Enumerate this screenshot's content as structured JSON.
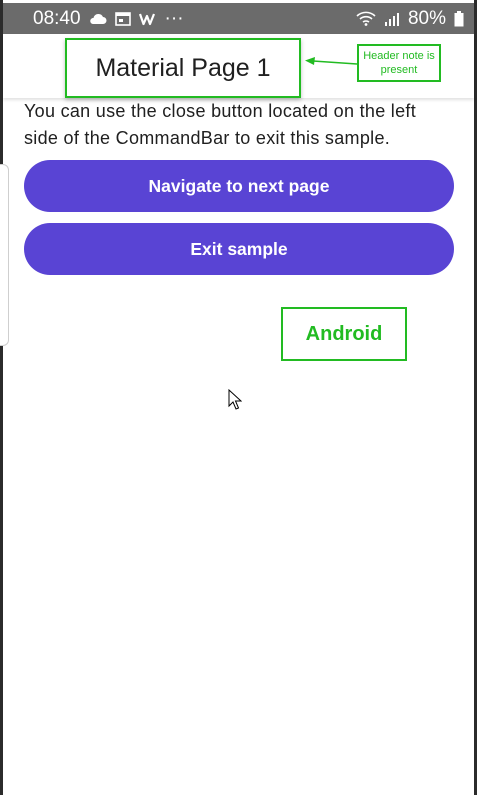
{
  "status_bar": {
    "time": "08:40",
    "more": "···",
    "battery": "80%",
    "icons": [
      "cloud-icon",
      "calendar-icon",
      "w-app-icon",
      "wifi-icon",
      "signal-icon",
      "battery-icon"
    ]
  },
  "header": {
    "title": "Material Page 1",
    "note": "Header note is present"
  },
  "content": {
    "description": "You can use the close button located on the left side of the CommandBar to exit this sample.",
    "navigate_button": "Navigate to next page",
    "exit_button": "Exit sample"
  },
  "platform_label": "Android",
  "colors": {
    "accent": "#5944d4",
    "annotation": "#22bb22",
    "status_bar": "#6b6b6b"
  }
}
